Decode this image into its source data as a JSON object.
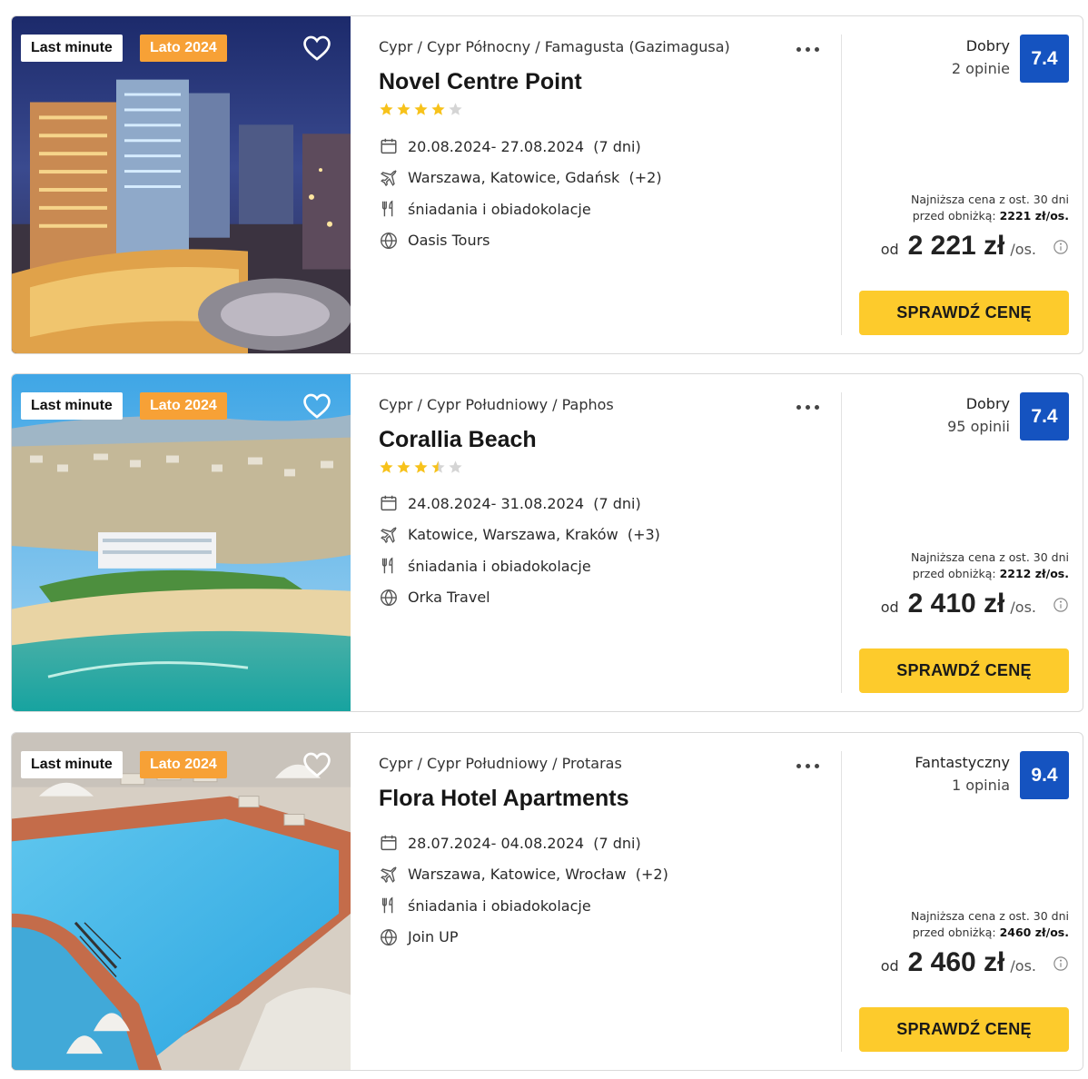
{
  "offers": [
    {
      "tag_lastminute": "Last minute",
      "tag_season": "Lato 2024",
      "breadcrumb": "Cypr / Cypr Północny / Famagusta (Gazimagusa)",
      "name": "Novel Centre Point",
      "stars": 4,
      "dates": "20.08.2024- 27.08.2024",
      "duration": "(7 dni)",
      "departures": "Warszawa, Katowice, Gdańsk",
      "departures_more": "(+2)",
      "board": "śniadania i obiadokolacje",
      "operator": "Oasis Tours",
      "rating_word": "Dobry",
      "rating_count": "2 opinie",
      "score": "7.4",
      "lowest_line1": "Najniższa cena z ost. 30 dni",
      "lowest_line2_prefix": "przed obniżką:",
      "lowest_price": "2221 zł/os.",
      "price_from": "od",
      "price": "2 221 zł",
      "price_unit": "/os.",
      "cta": "SPRAWDŹ CENĘ"
    },
    {
      "tag_lastminute": "Last minute",
      "tag_season": "Lato 2024",
      "breadcrumb": "Cypr / Cypr Południowy / Paphos",
      "name": "Corallia Beach",
      "stars": 3.5,
      "dates": "24.08.2024- 31.08.2024",
      "duration": "(7 dni)",
      "departures": "Katowice, Warszawa, Kraków",
      "departures_more": "(+3)",
      "board": "śniadania i obiadokolacje",
      "operator": "Orka Travel",
      "rating_word": "Dobry",
      "rating_count": "95 opinii",
      "score": "7.4",
      "lowest_line1": "Najniższa cena z ost. 30 dni",
      "lowest_line2_prefix": "przed obniżką:",
      "lowest_price": "2212 zł/os.",
      "price_from": "od",
      "price": "2 410 zł",
      "price_unit": "/os.",
      "cta": "SPRAWDŹ CENĘ"
    },
    {
      "tag_lastminute": "Last minute",
      "tag_season": "Lato 2024",
      "breadcrumb": "Cypr / Cypr Południowy / Protaras",
      "name": "Flora Hotel Apartments",
      "stars": 0,
      "dates": "28.07.2024- 04.08.2024",
      "duration": "(7 dni)",
      "departures": "Warszawa, Katowice, Wrocław",
      "departures_more": "(+2)",
      "board": "śniadania i obiadokolacje",
      "operator": "Join UP",
      "rating_word": "Fantastyczny",
      "rating_count": "1 opinia",
      "score": "9.4",
      "lowest_line1": "Najniższa cena z ost. 30 dni",
      "lowest_line2_prefix": "przed obniżką:",
      "lowest_price": "2460 zł/os.",
      "price_from": "od",
      "price": "2 460 zł",
      "price_unit": "/os.",
      "cta": "SPRAWDŹ CENĘ"
    }
  ],
  "icons": {
    "favorite": "heart-outline-icon",
    "more": "more-dots-icon",
    "dates": "calendar-icon",
    "departures": "plane-icon",
    "board": "fork-knife-icon",
    "operator": "globe-icon",
    "info": "info-circle-icon"
  },
  "colors": {
    "season_tag": "#f7a136",
    "score_badge": "#1553c0",
    "cta": "#fdcb2c",
    "star": "#f7c21b"
  }
}
